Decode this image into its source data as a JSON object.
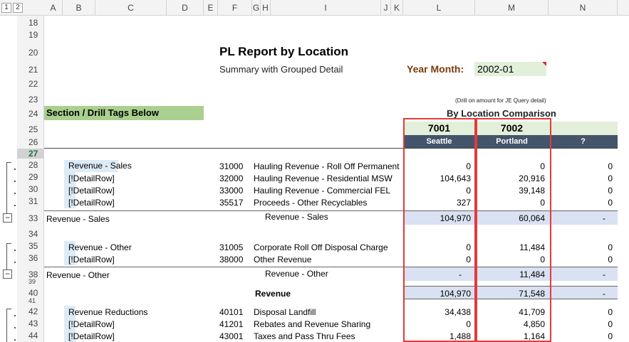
{
  "column_headers": [
    "A",
    "B",
    "C",
    "D",
    "E",
    "F",
    "G",
    "H",
    "I",
    "J",
    "K",
    "L",
    "M",
    "N"
  ],
  "outline_levels": [
    "1",
    "2"
  ],
  "row_numbers": [
    "18",
    "19",
    "20",
    "21",
    "22",
    "23",
    "24",
    "25",
    "26",
    "27",
    "28",
    "29",
    "30",
    "31",
    "33",
    "34",
    "35",
    "36",
    "38",
    "39",
    "40",
    "41",
    "42",
    "43",
    "44"
  ],
  "report": {
    "title": "PL Report by Location",
    "subtitle": "Summary with Grouped Detail",
    "year_month_label": "Year Month:",
    "year_month_value": "2002-01",
    "drill_note": "(Drill on amount for JE Query detail)",
    "section_header": "Section / Drill Tags Below",
    "comparison_title": "By Location Comparison"
  },
  "locations": [
    {
      "code": "7001",
      "name": "Seattle"
    },
    {
      "code": "7002",
      "name": "Portland"
    },
    {
      "code": "",
      "name": "?"
    }
  ],
  "rows": [
    {
      "row": "28",
      "tag": "Revenue - Sales",
      "acct": "31000",
      "desc": "Hauling Revenue - Roll Off Permanent",
      "seattle": "0",
      "portland": "0",
      "other": "0"
    },
    {
      "row": "29",
      "tag": "[!DetailRow]",
      "acct": "32000",
      "desc": "Hauling Revenue - Residential MSW",
      "seattle": "104,643",
      "portland": "20,916",
      "other": "0"
    },
    {
      "row": "30",
      "tag": "[!DetailRow]",
      "acct": "33000",
      "desc": "Hauling Revenue - Commercial FEL",
      "seattle": "0",
      "portland": "39,148",
      "other": "0"
    },
    {
      "row": "31",
      "tag": "[!DetailRow]",
      "acct": "35517",
      "desc": "Proceeds - Other Recyclables",
      "seattle": "327",
      "portland": "0",
      "other": "0"
    },
    {
      "row": "35",
      "tag": "Revenue - Other",
      "acct": "31005",
      "desc": "Corporate Roll Off Disposal Charge",
      "seattle": "0",
      "portland": "11,484",
      "other": "0"
    },
    {
      "row": "36",
      "tag": "[!DetailRow]",
      "acct": "38000",
      "desc": "Other Revenue",
      "seattle": "0",
      "portland": "0",
      "other": "0"
    },
    {
      "row": "42",
      "tag": "Revenue Reductions",
      "acct": "40101",
      "desc": "Disposal Landfill",
      "seattle": "34,438",
      "portland": "41,709",
      "other": "0"
    },
    {
      "row": "43",
      "tag": "[!DetailRow]",
      "acct": "41201",
      "desc": "Rebates and Revenue Sharing",
      "seattle": "0",
      "portland": "4,850",
      "other": "0"
    },
    {
      "row": "44",
      "tag": "[!DetailRow]",
      "acct": "43001",
      "desc": "Taxes and Pass Thru Fees",
      "seattle": "1,488",
      "portland": "1,164",
      "other": "0"
    }
  ],
  "subtotals": [
    {
      "row": "33",
      "left_label": "Revenue - Sales",
      "center_label": "Revenue - Sales",
      "seattle": "104,970",
      "portland": "60,064",
      "other": "-"
    },
    {
      "row": "38",
      "left_label": "Revenue - Other",
      "center_label": "Revenue - Other",
      "seattle": "-",
      "portland": "11,484",
      "other": "-"
    },
    {
      "row": "40",
      "left_label": "",
      "center_label": "Revenue",
      "seattle": "104,970",
      "portland": "71,548",
      "other": "-"
    }
  ]
}
